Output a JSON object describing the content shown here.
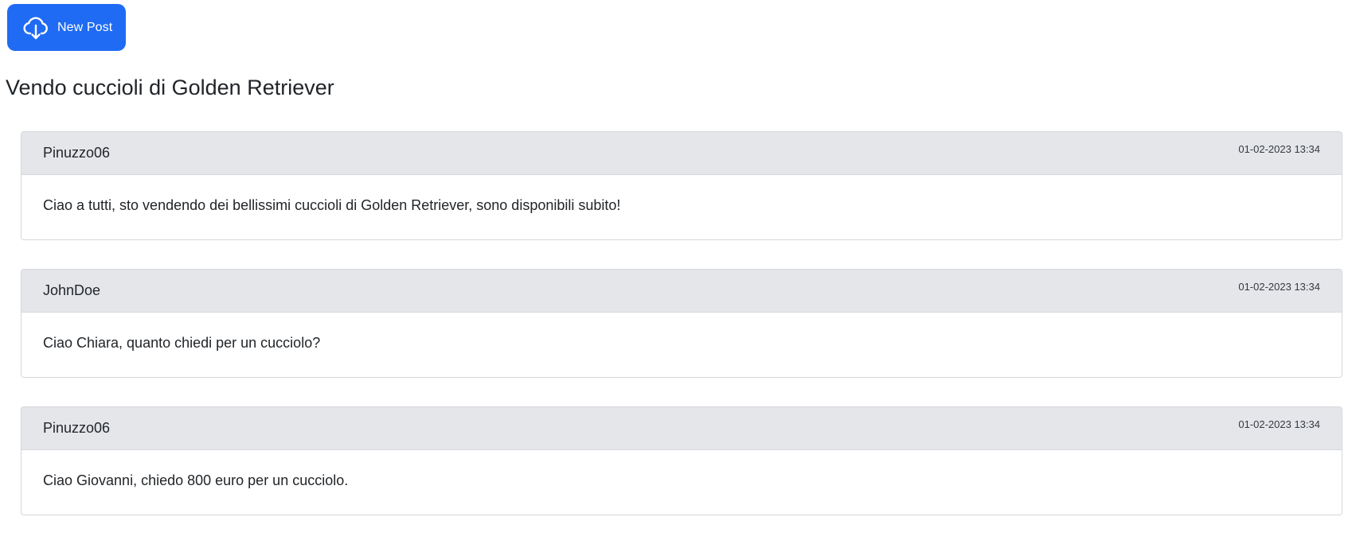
{
  "toolbar": {
    "new_post_label": "New Post",
    "new_post_icon": "cloud-download-icon",
    "accent": "#1f6bf3"
  },
  "page": {
    "title": "Vendo cuccioli di Golden Retriever"
  },
  "posts": [
    {
      "author": "Pinuzzo06",
      "date": "01-02-2023 13:34",
      "text": "Ciao a tutti, sto vendendo dei bellissimi cuccioli di Golden Retriever, sono disponibili subito!"
    },
    {
      "author": "JohnDoe",
      "date": "01-02-2023 13:34",
      "text": "Ciao Chiara, quanto chiedi per un cucciolo?"
    },
    {
      "author": "Pinuzzo06",
      "date": "01-02-2023 13:34",
      "text": "Ciao Giovanni, chiedo 800 euro per un cucciolo."
    }
  ]
}
